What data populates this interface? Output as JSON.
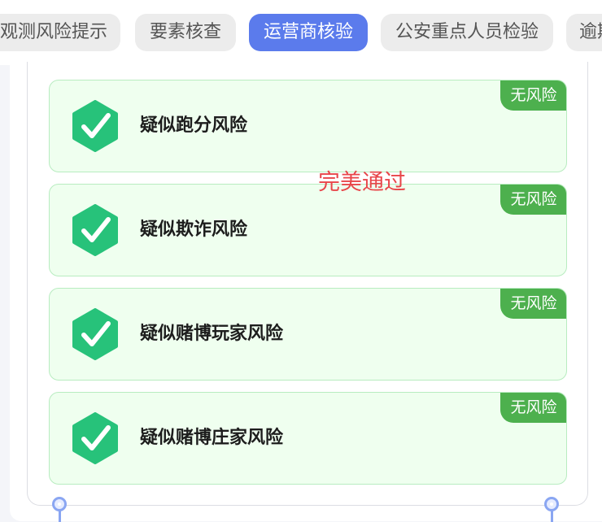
{
  "tabs": [
    {
      "label": "观测风险提示",
      "active": false
    },
    {
      "label": "要素核查",
      "active": false
    },
    {
      "label": "运营商核验",
      "active": true
    },
    {
      "label": "公安重点人员检验",
      "active": false
    },
    {
      "label": "逾期",
      "active": false
    }
  ],
  "risk_items": [
    {
      "title": "疑似跑分风险",
      "badge": "无风险",
      "icon": "check-hexagon-icon"
    },
    {
      "title": "疑似欺诈风险",
      "badge": "无风险",
      "icon": "check-hexagon-icon"
    },
    {
      "title": "疑似赌博玩家风险",
      "badge": "无风险",
      "icon": "check-hexagon-icon"
    },
    {
      "title": "疑似赌博庄家风险",
      "badge": "无风险",
      "icon": "check-hexagon-icon"
    }
  ],
  "watermark_text": "完美通过",
  "colors": {
    "tab_active": "#5b7bec",
    "tab_inactive": "#ececec",
    "card_background": "#efffef",
    "card_border": "#b8ecc0",
    "badge": "#4db04e",
    "icon_hexagon": "#27c27a",
    "watermark": "#e8464a"
  }
}
